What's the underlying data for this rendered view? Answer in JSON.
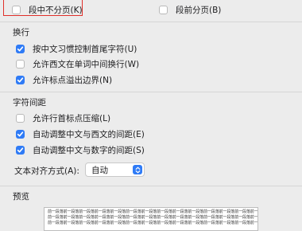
{
  "pagination": {
    "keep_lines_together": {
      "label": "段中不分页(K)",
      "checked": false
    },
    "page_break_before": {
      "label": "段前分页(B)",
      "checked": false
    }
  },
  "line_break": {
    "title": "换行",
    "options": [
      {
        "label": "按中文习惯控制首尾字符(U)",
        "checked": true
      },
      {
        "label": "允许西文在单词中间换行(W)",
        "checked": false
      },
      {
        "label": "允许标点溢出边界(N)",
        "checked": true
      }
    ]
  },
  "char_spacing": {
    "title": "字符间距",
    "options": [
      {
        "label": "允许行首标点压缩(L)",
        "checked": false
      },
      {
        "label": "自动调整中文与西文的间距(E)",
        "checked": true
      },
      {
        "label": "自动调整中文与数字的间距(S)",
        "checked": true
      }
    ]
  },
  "text_alignment": {
    "label": "文本对齐方式(A):",
    "value": "自动"
  },
  "preview": {
    "title": "预览",
    "line": "前一段落前一段落前一段落前一段落前一段落前一段落前一段落前一段落前一段落前一段落前一段落前一段落前一段落前一段落前一段落"
  },
  "colors": {
    "accent": "#2f7bf6",
    "background": "#ececec",
    "highlight_frame": "#e0302a"
  }
}
